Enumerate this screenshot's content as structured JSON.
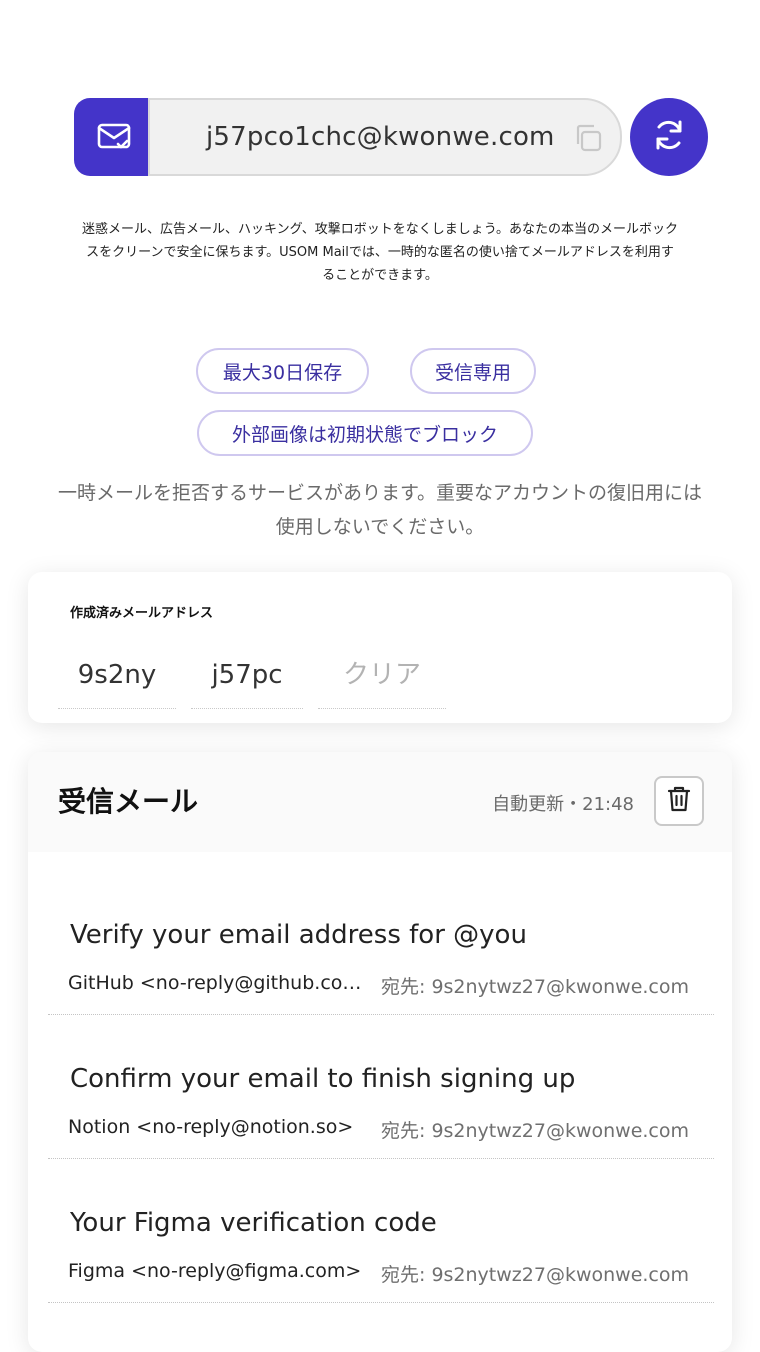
{
  "header": {
    "email_address": "j57pco1chc@kwonwe.com",
    "description": "迷惑メール、広告メール、ハッキング、攻撃ロボットをなくしましょう。あなたの本当のメールボックスをクリーンで安全に保ちます。USOM Mailでは、一時的な匿名の使い捨てメールアドレスを利用することができます。",
    "chips": [
      "最大30日保存",
      "受信専用",
      "外部画像は初期状態でブロック"
    ],
    "warning": "一時メールを拒否するサービスがあります。重要なアカウントの復旧用には使用しないでください。"
  },
  "created": {
    "title": "作成済みメールアドレス",
    "tabs": [
      "9s2ny",
      "j57pc"
    ],
    "clear_label": "クリア"
  },
  "inbox": {
    "title": "受信メール",
    "status": "自動更新・21:48",
    "messages": [
      {
        "subject": "Verify your email address for @you",
        "from": "GitHub <no-reply@github.com>",
        "to": "宛先: 9s2nytwz27@kwonwe.com"
      },
      {
        "subject": "Confirm your email to finish signing up",
        "from": "Notion <no-reply@notion.so>",
        "to": "宛先: 9s2nytwz27@kwonwe.com"
      },
      {
        "subject": "Your Figma verification code",
        "from": "Figma <no-reply@figma.com>",
        "to": "宛先: 9s2nytwz27@kwonwe.com"
      }
    ]
  },
  "colors": {
    "accent": "#4434c9",
    "chip_text": "#3a2fa0",
    "chip_border": "#cfc8ef"
  },
  "icons": {
    "mail_badge": "mail-check-icon",
    "copy": "copy-icon",
    "refresh": "refresh-icon",
    "trash": "trash-icon"
  }
}
